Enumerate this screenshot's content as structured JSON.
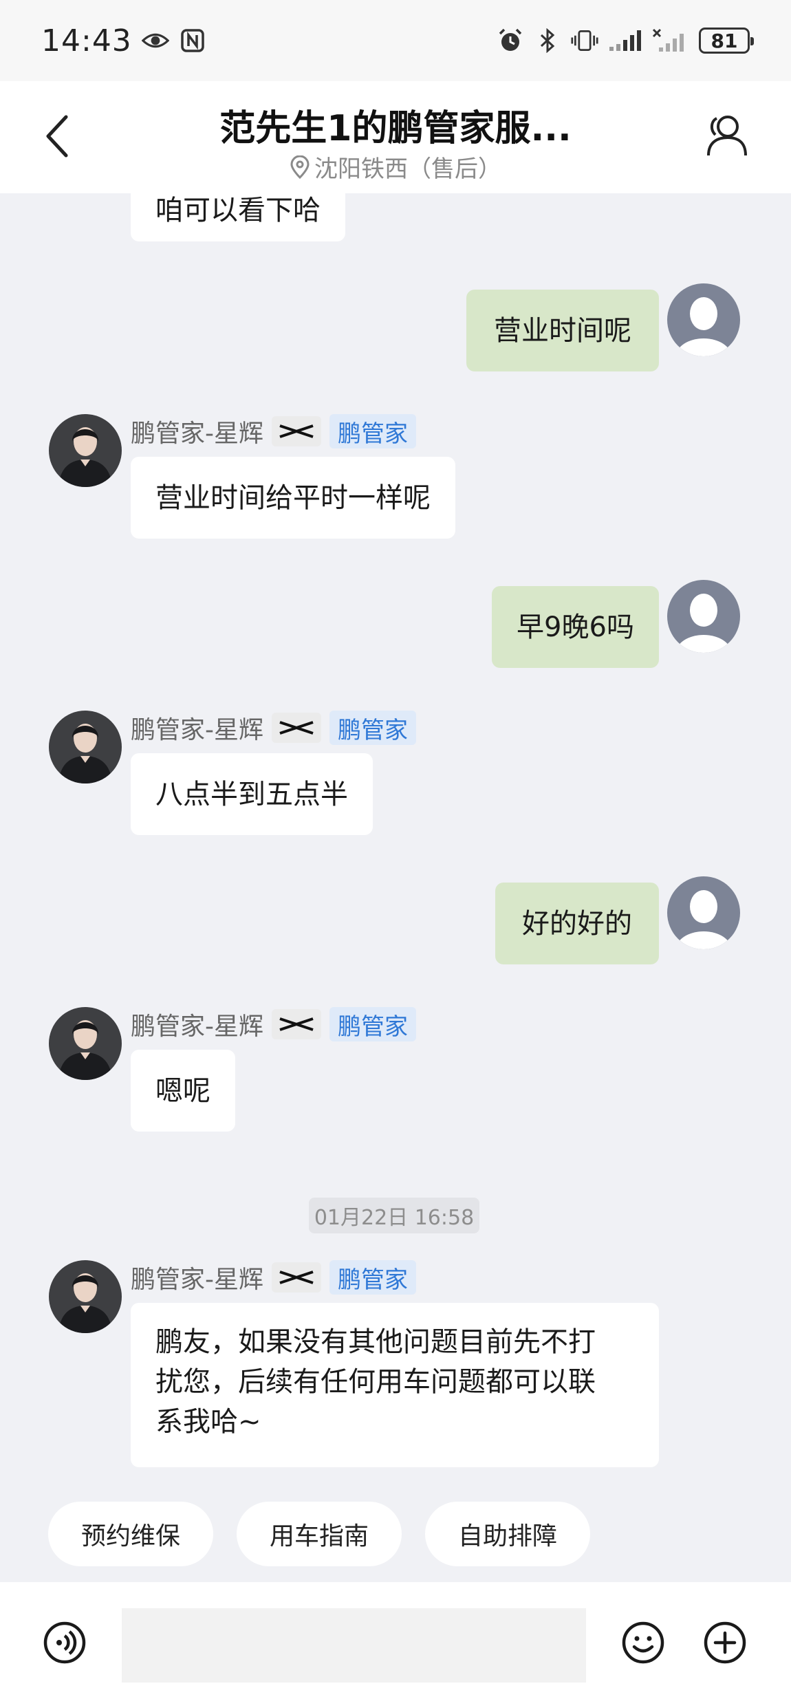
{
  "status_bar": {
    "time": "14:43",
    "battery": "81",
    "icons": [
      "eye-icon",
      "nfc-icon",
      "alarm-icon",
      "bluetooth-icon",
      "vibrate-icon",
      "signal-icon",
      "no-signal-icon",
      "battery-icon"
    ]
  },
  "header": {
    "title": "范先生1的鹏管家服...",
    "subtitle": "沈阳铁西（售后）",
    "icons": [
      "back-chevron-icon",
      "location-pin-icon",
      "profile-icon"
    ]
  },
  "agent": {
    "name": "鹏管家-星辉",
    "role": "鹏管家"
  },
  "messages": [
    {
      "from": "agent",
      "text": "咱可以看下哈",
      "partial": true
    },
    {
      "from": "me",
      "text": "营业时间呢"
    },
    {
      "from": "agent",
      "text": "营业时间给平时一样呢"
    },
    {
      "from": "me",
      "text": "早9晚6吗"
    },
    {
      "from": "agent",
      "text": "八点半到五点半"
    },
    {
      "from": "me",
      "text": "好的好的"
    },
    {
      "from": "agent",
      "text": "嗯呢"
    },
    {
      "timestamp": "01月22日 16:58"
    },
    {
      "from": "agent",
      "lines": [
        "鹏友，如果没有其他问题目前先不打",
        "扰您，后续有任何用车问题都可以联",
        "系我哈~"
      ]
    }
  ],
  "quick_actions": [
    "预约维保",
    "用车指南",
    "自助排障"
  ],
  "input_bar": {
    "placeholder": "",
    "icons": [
      "voice-icon",
      "emoji-icon",
      "plus-icon"
    ]
  },
  "colors": {
    "background": "#f0f1f5",
    "my_bubble": "#d8e7c9",
    "agent_bubble": "#ffffff",
    "role_tag_text": "#2f78d6",
    "role_tag_bg": "#dfeaf9"
  }
}
